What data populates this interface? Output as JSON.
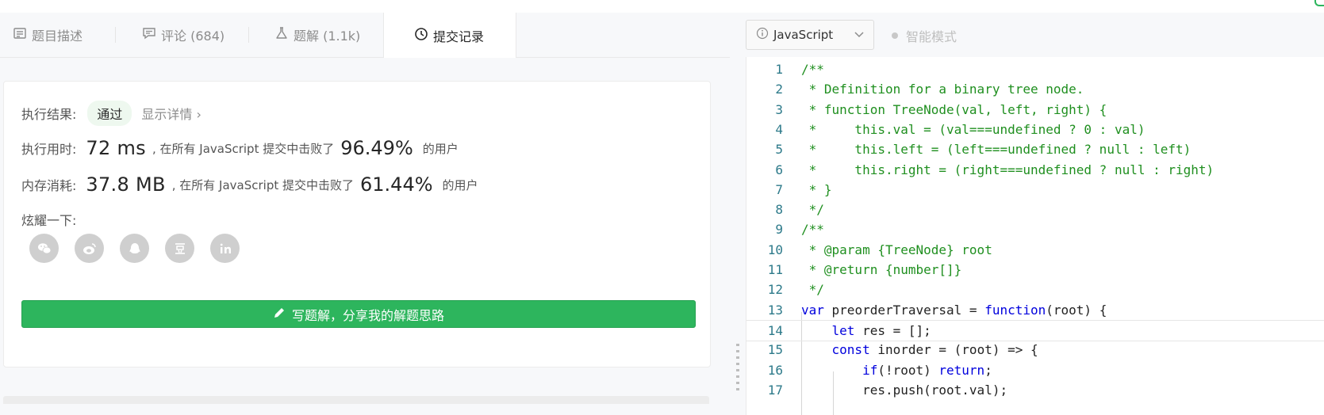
{
  "tabs": [
    {
      "label": "题目描述",
      "icon": "description-icon"
    },
    {
      "label": "评论 (684)",
      "icon": "comment-icon"
    },
    {
      "label": "题解 (1.1k)",
      "icon": "flask-icon"
    },
    {
      "label": "提交记录",
      "icon": "clock-icon"
    }
  ],
  "result": {
    "status_label": "执行结果:",
    "status_value": "通过",
    "detail_link": "显示详情 ›",
    "time_label": "执行用时:",
    "time_value": "72 ms",
    "time_mid": ", 在所有 JavaScript 提交中击败了",
    "time_pct": "96.49%",
    "time_tail": "的用户",
    "mem_label": "内存消耗:",
    "mem_value": "37.8 MB",
    "mem_mid": ", 在所有 JavaScript 提交中击败了",
    "mem_pct": "61.44%",
    "mem_tail": "的用户",
    "share_label": "炫耀一下:",
    "share_icons": [
      "wechat-icon",
      "weibo-icon",
      "qq-icon",
      "douban-icon",
      "linkedin-icon"
    ],
    "write_button": "写题解，分享我的解题思路"
  },
  "editor": {
    "language": "JavaScript",
    "mode_label": "智能模式",
    "lines": [
      {
        "n": "1",
        "text": "/**",
        "cls": "cm"
      },
      {
        "n": "2",
        "text": " * Definition for a binary tree node.",
        "cls": "cm"
      },
      {
        "n": "3",
        "text": " * function TreeNode(val, left, right) {",
        "cls": "cm"
      },
      {
        "n": "4",
        "text": " *     this.val = (val===undefined ? 0 : val)",
        "cls": "cm"
      },
      {
        "n": "5",
        "text": " *     this.left = (left===undefined ? null : left)",
        "cls": "cm"
      },
      {
        "n": "6",
        "text": " *     this.right = (right===undefined ? null : right)",
        "cls": "cm"
      },
      {
        "n": "7",
        "text": " * }",
        "cls": "cm"
      },
      {
        "n": "8",
        "text": " */",
        "cls": "cm"
      },
      {
        "n": "9",
        "text": "/**",
        "cls": "cm"
      },
      {
        "n": "10",
        "text": " * @param {TreeNode} root",
        "cls": "cm"
      },
      {
        "n": "11",
        "text": " * @return {number[]}",
        "cls": "cm"
      },
      {
        "n": "12",
        "text": " */",
        "cls": "cm"
      },
      {
        "n": "13",
        "text": "var preorderTraversal = function(root) {",
        "cls": "code"
      },
      {
        "n": "14",
        "text": "    let res = [];",
        "cls": "code"
      },
      {
        "n": "15",
        "text": "    const inorder = (root) => {",
        "cls": "code"
      },
      {
        "n": "16",
        "text": "        if(!root) return;",
        "cls": "code"
      },
      {
        "n": "17",
        "text": "        res.push(root.val);",
        "cls": "code"
      }
    ]
  }
}
